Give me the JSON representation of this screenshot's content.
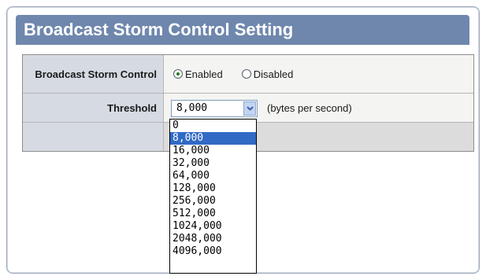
{
  "panel": {
    "title": "Broadcast Storm Control Setting"
  },
  "form": {
    "broadcast_storm_control": {
      "label": "Broadcast Storm Control",
      "options": [
        {
          "label": "Enabled",
          "selected": true
        },
        {
          "label": "Disabled",
          "selected": false
        }
      ]
    },
    "threshold": {
      "label": "Threshold",
      "value": "8,000",
      "unit": "(bytes per second)"
    }
  },
  "threshold_dropdown": {
    "selected": "8,000",
    "options": [
      "0",
      "8,000",
      "16,000",
      "32,000",
      "64,000",
      "128,000",
      "256,000",
      "512,000",
      "1024,000",
      "2048,000",
      "4096,000"
    ]
  },
  "colors": {
    "title_bar": "#6f87ad",
    "label_bg": "#d6dae2",
    "value_bg": "#f4f4f2",
    "selection": "#316ac5"
  }
}
